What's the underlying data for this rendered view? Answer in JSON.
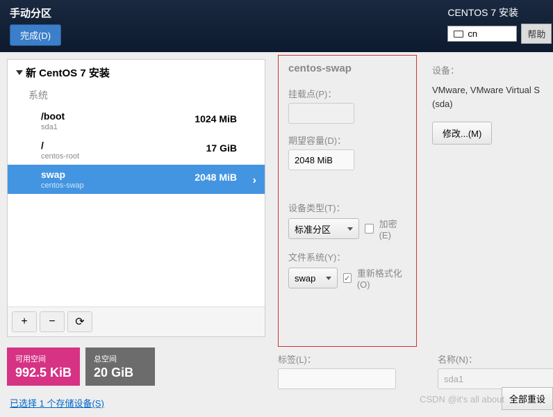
{
  "topbar": {
    "title": "手动分区",
    "done_label": "完成(D)",
    "install_label": "CENTOS 7 安装",
    "lang": "cn",
    "help_label": "帮助"
  },
  "left": {
    "header": "新 CentOS 7 安装",
    "section": "系统",
    "partitions": [
      {
        "name": "/boot",
        "sub": "sda1",
        "size": "1024 MiB",
        "selected": false
      },
      {
        "name": "/",
        "sub": "centos-root",
        "size": "17 GiB",
        "selected": false
      },
      {
        "name": "swap",
        "sub": "centos-swap",
        "size": "2048 MiB",
        "selected": true
      }
    ],
    "toolbar": {
      "add": "+",
      "remove": "−",
      "reload": "⟳"
    }
  },
  "stats": {
    "avail_label": "可用空间",
    "avail_value": "992.5 KiB",
    "total_label": "总空间",
    "total_value": "20 GiB"
  },
  "storage_link": "已选择 1 个存储设备(S)",
  "detail": {
    "title": "centos-swap",
    "mount_label": "挂载点(P)：",
    "mount_value": "",
    "capacity_label": "期望容量(D)：",
    "capacity_value": "2048 MiB",
    "devtype_label": "设备类型(T)：",
    "devtype_value": "标准分区",
    "encrypt_label": "加密(E)",
    "fs_label": "文件系统(Y)：",
    "fs_value": "swap",
    "reformat_label": "重新格式化(O)"
  },
  "device": {
    "label": "设备：",
    "text1": "VMware, VMware Virtual S",
    "text2": "(sda)",
    "modify_label": "修改...(M)"
  },
  "bottom": {
    "tag_label": "标签(L)：",
    "tag_value": "",
    "name_label": "名称(N)：",
    "name_value": "sda1"
  },
  "reset_label": "全部重设",
  "watermark": "CSDN @it's all about"
}
